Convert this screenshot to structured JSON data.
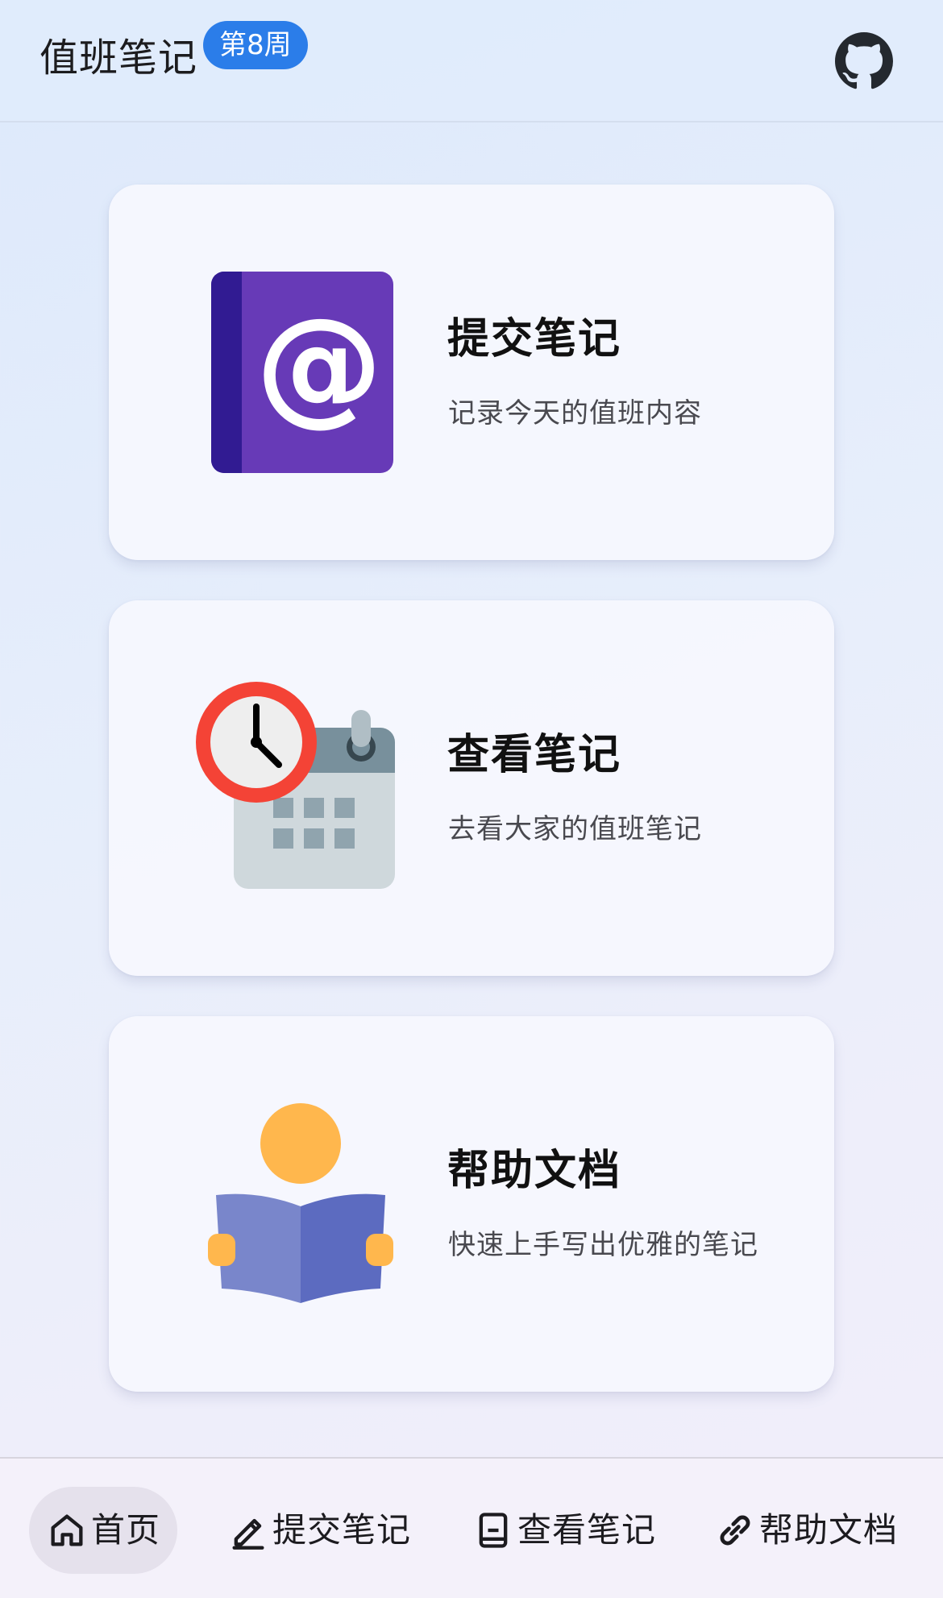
{
  "header": {
    "title": "值班笔记",
    "week_badge": "第8周",
    "github_icon": "github-icon"
  },
  "cards": [
    {
      "title": "提交笔记",
      "subtitle": "记录今天的值班内容",
      "icon": "address-book-at-icon"
    },
    {
      "title": "查看笔记",
      "subtitle": "去看大家的值班笔记",
      "icon": "calendar-clock-icon"
    },
    {
      "title": "帮助文档",
      "subtitle": "快速上手写出优雅的笔记",
      "icon": "reading-person-icon"
    }
  ],
  "bottom_nav": {
    "active": "首页",
    "items": [
      {
        "label": "首页",
        "icon": "home-icon"
      },
      {
        "label": "提交笔记",
        "icon": "pencil-icon"
      },
      {
        "label": "查看笔记",
        "icon": "document-icon"
      },
      {
        "label": "帮助文档",
        "icon": "link-icon"
      }
    ]
  },
  "colors": {
    "badge": "#2b7de9",
    "book_purple": "#673ab7",
    "book_spine": "#311b92",
    "clock_red": "#f44336",
    "calendar_gray": "#cfd8dc",
    "calendar_header": "#78909c",
    "reader_orange": "#ffb74d",
    "reader_book": "#5c6bc0",
    "nav_active_bg": "#e5e1ec"
  }
}
